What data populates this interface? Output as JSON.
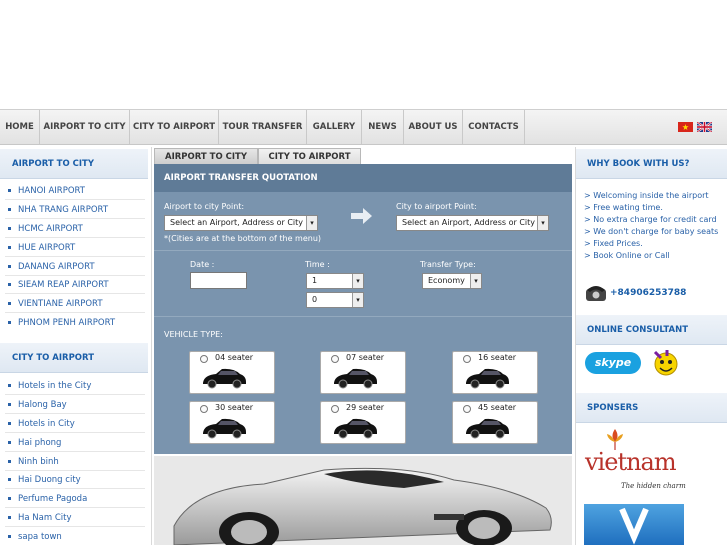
{
  "nav": {
    "items": [
      "HOME",
      "AIRPORT TO CITY",
      "CITY TO AIRPORT",
      "TOUR TRANSFER",
      "GALLERY",
      "NEWS",
      "ABOUT US",
      "CONTACTS"
    ]
  },
  "left": {
    "airport_to_city_heading": "AIRPORT TO CITY",
    "airport_items": [
      "HANOI AIRPORT",
      "NHA TRANG AIRPORT",
      "HCMC AIRPORT",
      "HUE AIRPORT",
      "DANANG AIRPORT",
      "SIEAM REAP AIRPORT",
      "VIENTIANE AIRPORT",
      "PHNOM PENH AIRPORT"
    ],
    "city_to_airport_heading": "CITY TO AIRPORT",
    "city_items": [
      "Hotels in the City",
      "Halong Bay",
      "Hotels in City",
      "Hai phong",
      "Ninh binh",
      "Hai Duong city",
      "Perfume Pagoda",
      "Ha Nam City",
      "sapa town"
    ]
  },
  "tabs": [
    "AIRPORT TO CITY",
    "CITY TO AIRPORT"
  ],
  "form": {
    "title": "AIRPORT TRANSFER QUOTATION",
    "airport_to_city_label": "Airport to city Point:",
    "city_to_airport_label": "City to airport Point:",
    "select_placeholder": "Select an Airport, Address or City",
    "cities_note": "*(Cities are at the bottom of the menu)",
    "date_label": "Date :",
    "time_label": "Time :",
    "transfer_type_label": "Transfer Type:",
    "hour_value": "1",
    "minute_value": "0",
    "transfer_type_value": "Economy",
    "vehicle_type_label": "VEHICLE TYPE:",
    "vehicles": [
      "04 seater",
      "07 seater",
      "16 seater",
      "30 seater",
      "29 seater",
      "45 seater"
    ]
  },
  "right": {
    "why_heading": "WHY BOOK WITH US?",
    "reasons": [
      "> Welcoming inside the airport",
      "> Free wating time.",
      "> No extra charge for credit card",
      "> We don't charge for baby seats",
      "> Fixed Prices.",
      "> Book Online or Call"
    ],
    "phone": "+84906253788",
    "consultant_heading": "ONLINE CONSULTANT",
    "skype_label": "skype",
    "sponsors_heading": "SPONSERS",
    "sponsor_logo_text": "vietnam",
    "sponsor_tagline": "The hidden charm"
  },
  "colors": {
    "accent_blue": "#1a5ea8",
    "panel": "#7a94ae",
    "panel_header": "#5f7b97"
  }
}
